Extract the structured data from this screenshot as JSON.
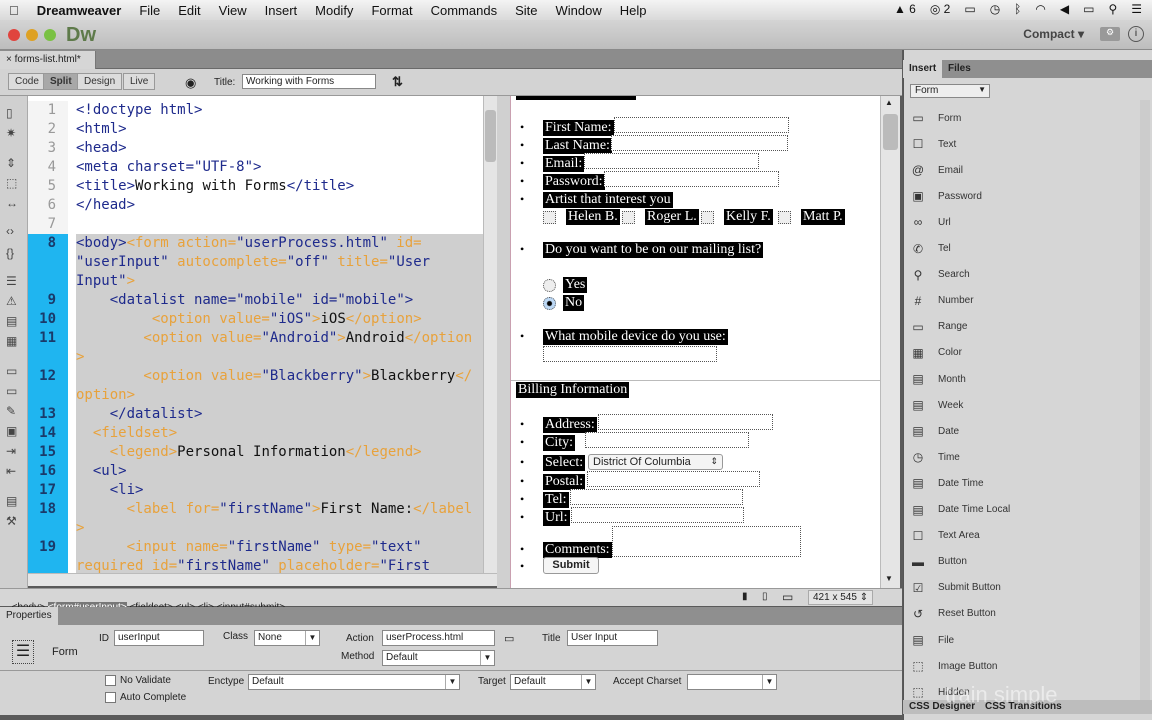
{
  "menubar": {
    "app": "Dreamweaver",
    "items": [
      "File",
      "Edit",
      "View",
      "Insert",
      "Modify",
      "Format",
      "Commands",
      "Site",
      "Window",
      "Help"
    ],
    "status": [
      "6",
      "2"
    ]
  },
  "window": {
    "logo": "Dw",
    "workspace": "Compact"
  },
  "doc_tab": "forms-list.html*",
  "toolbar": {
    "views": [
      "Code",
      "Split",
      "Design",
      "Live"
    ],
    "title_label": "Title:",
    "title_value": "Working with Forms"
  },
  "code": {
    "rows": [
      {
        "n": "1",
        "segs": [
          [
            "t",
            "<!doctype html>"
          ]
        ]
      },
      {
        "n": "2",
        "segs": [
          [
            "t",
            "<html>"
          ]
        ]
      },
      {
        "n": "3",
        "segs": [
          [
            "t",
            "<head>"
          ]
        ]
      },
      {
        "n": "4",
        "segs": [
          [
            "t",
            "<meta charset="
          ],
          [
            "s",
            "\"UTF-8\""
          ],
          [
            "t",
            ">"
          ]
        ]
      },
      {
        "n": "5",
        "segs": [
          [
            "t",
            "<title>"
          ],
          [
            "x",
            "Working with Forms"
          ],
          [
            "t",
            "</title>"
          ]
        ]
      },
      {
        "n": "6",
        "segs": [
          [
            "t",
            "</head>"
          ]
        ]
      },
      {
        "n": "7",
        "segs": []
      },
      {
        "n": "8",
        "sel": true,
        "segs": [
          [
            "t",
            "<body>"
          ],
          [
            "a",
            "<form action="
          ],
          [
            "s",
            "\"userProcess.html\""
          ],
          [
            "a",
            " id="
          ]
        ]
      },
      {
        "n": "",
        "sel": true,
        "segs": [
          [
            "s",
            "\"userInput\""
          ],
          [
            "a",
            " autocomplete="
          ],
          [
            "s",
            "\"off\""
          ],
          [
            "a",
            " title="
          ],
          [
            "s",
            "\"User"
          ]
        ]
      },
      {
        "n": "",
        "sel": true,
        "segs": [
          [
            "s",
            "Input\""
          ],
          [
            "a",
            ">"
          ]
        ]
      },
      {
        "n": "9",
        "sel": true,
        "segs": [
          [
            "t",
            "    <datalist name="
          ],
          [
            "s",
            "\"mobile\""
          ],
          [
            "t",
            " id="
          ],
          [
            "s",
            "\"mobile\""
          ],
          [
            "t",
            ">"
          ]
        ]
      },
      {
        "n": "10",
        "sel": true,
        "segs": [
          [
            "a",
            "         <option value="
          ],
          [
            "s",
            "\"iOS\""
          ],
          [
            "a",
            ">"
          ],
          [
            "x",
            "iOS"
          ],
          [
            "a",
            "</option>"
          ]
        ]
      },
      {
        "n": "11",
        "sel": true,
        "segs": [
          [
            "a",
            "        <option value="
          ],
          [
            "s",
            "\"Android\""
          ],
          [
            "a",
            ">"
          ],
          [
            "x",
            "Android"
          ],
          [
            "a",
            "</option"
          ]
        ]
      },
      {
        "n": "",
        "sel": true,
        "segs": [
          [
            "a",
            ">"
          ]
        ]
      },
      {
        "n": "12",
        "sel": true,
        "segs": [
          [
            "a",
            "        <option value="
          ],
          [
            "s",
            "\"Blackberry\""
          ],
          [
            "a",
            ">"
          ],
          [
            "x",
            "Blackberry"
          ],
          [
            "a",
            "</"
          ]
        ]
      },
      {
        "n": "",
        "sel": true,
        "segs": [
          [
            "a",
            "option>"
          ]
        ]
      },
      {
        "n": "13",
        "sel": true,
        "segs": [
          [
            "t",
            "    </datalist>"
          ]
        ]
      },
      {
        "n": "14",
        "sel": true,
        "segs": [
          [
            "a",
            "  <fieldset>"
          ]
        ]
      },
      {
        "n": "15",
        "sel": true,
        "segs": [
          [
            "a",
            "    <legend>"
          ],
          [
            "x",
            "Personal Information"
          ],
          [
            "a",
            "</legend>"
          ]
        ]
      },
      {
        "n": "16",
        "sel": true,
        "segs": [
          [
            "t",
            "  <ul>"
          ]
        ]
      },
      {
        "n": "17",
        "sel": true,
        "segs": [
          [
            "t",
            "    <li>"
          ]
        ]
      },
      {
        "n": "18",
        "sel": true,
        "segs": [
          [
            "a",
            "      <label for="
          ],
          [
            "s",
            "\"firstName\""
          ],
          [
            "a",
            ">"
          ],
          [
            "x",
            "First Name:"
          ],
          [
            "a",
            "</label"
          ]
        ]
      },
      {
        "n": "",
        "sel": true,
        "segs": [
          [
            "a",
            ">"
          ]
        ]
      },
      {
        "n": "19",
        "sel": true,
        "segs": [
          [
            "a",
            "      <input name="
          ],
          [
            "s",
            "\"firstName\""
          ],
          [
            "a",
            " type="
          ],
          [
            "s",
            "\"text\""
          ]
        ]
      },
      {
        "n": "",
        "sel": true,
        "segs": [
          [
            "a",
            "required id="
          ],
          [
            "s",
            "\"firstName\""
          ],
          [
            "a",
            " placeholder="
          ],
          [
            "s",
            "\"First"
          ]
        ]
      }
    ]
  },
  "design": {
    "personal": [
      [
        "First Name:",
        ""
      ],
      [
        "Last Name:",
        ""
      ],
      [
        "Email:",
        ""
      ],
      [
        "Password:",
        ""
      ]
    ],
    "artist_label": "Artist that interest you",
    "artists": [
      "Helen B.",
      "Roger L.",
      "Kelly F.",
      "Matt P."
    ],
    "mailing_q": "Do you want to be on our mailing list?",
    "radios": [
      {
        "label": "Yes",
        "checked": false
      },
      {
        "label": "No",
        "checked": true
      }
    ],
    "mobile_q": "What mobile device do you use:",
    "billing_legend": "Billing Information",
    "billing": [
      "Address:",
      "City:",
      "Select:",
      "Postal:",
      "Tel:",
      "Url:"
    ],
    "select_value": "District Of Columbia",
    "comments": "Comments:",
    "submit": "Submit"
  },
  "tagbar": {
    "tags": [
      "<body>",
      "<form#userInput>",
      "<fieldset>",
      "<ul>",
      "<li>",
      "<input#submit>"
    ],
    "size": "421 x 545"
  },
  "properties": {
    "tab": "Properties",
    "type": "Form",
    "id_label": "ID",
    "id": "userInput",
    "class_label": "Class",
    "class": "None",
    "action_label": "Action",
    "action": "userProcess.html",
    "method_label": "Method",
    "method": "Default",
    "title_label": "Title",
    "title": "User Input",
    "novalidate": "No Validate",
    "autocomplete": "Auto Complete",
    "enctype_label": "Enctype",
    "enctype": "Default",
    "target_label": "Target",
    "target": "Default",
    "charset_label": "Accept Charset",
    "charset": ""
  },
  "insert": {
    "tabs": [
      "Insert",
      "Files"
    ],
    "category": "Form",
    "items": [
      {
        "label": "Form",
        "icon": "▭"
      },
      {
        "label": "Text",
        "icon": "☐"
      },
      {
        "label": "Email",
        "icon": "@"
      },
      {
        "label": "Password",
        "icon": "▣"
      },
      {
        "label": "Url",
        "icon": "∞"
      },
      {
        "label": "Tel",
        "icon": "✆"
      },
      {
        "label": "Search",
        "icon": "⚲"
      },
      {
        "label": "Number",
        "icon": "#"
      },
      {
        "label": "Range",
        "icon": "▭"
      },
      {
        "label": "Color",
        "icon": "▦"
      },
      {
        "label": "Month",
        "icon": "▤"
      },
      {
        "label": "Week",
        "icon": "▤"
      },
      {
        "label": "Date",
        "icon": "▤"
      },
      {
        "label": "Time",
        "icon": "◷"
      },
      {
        "label": "Date Time",
        "icon": "▤"
      },
      {
        "label": "Date Time Local",
        "icon": "▤"
      },
      {
        "label": "Text Area",
        "icon": "☐"
      },
      {
        "label": "Button",
        "icon": "▬"
      },
      {
        "label": "Submit Button",
        "icon": "☑"
      },
      {
        "label": "Reset Button",
        "icon": "↺"
      },
      {
        "label": "File",
        "icon": "▤"
      },
      {
        "label": "Image Button",
        "icon": "⬚"
      },
      {
        "label": "Hidden",
        "icon": "⬚"
      }
    ]
  },
  "bottom_tabs": [
    "CSS Designer",
    "CSS Transitions"
  ],
  "watermark": "train simple"
}
